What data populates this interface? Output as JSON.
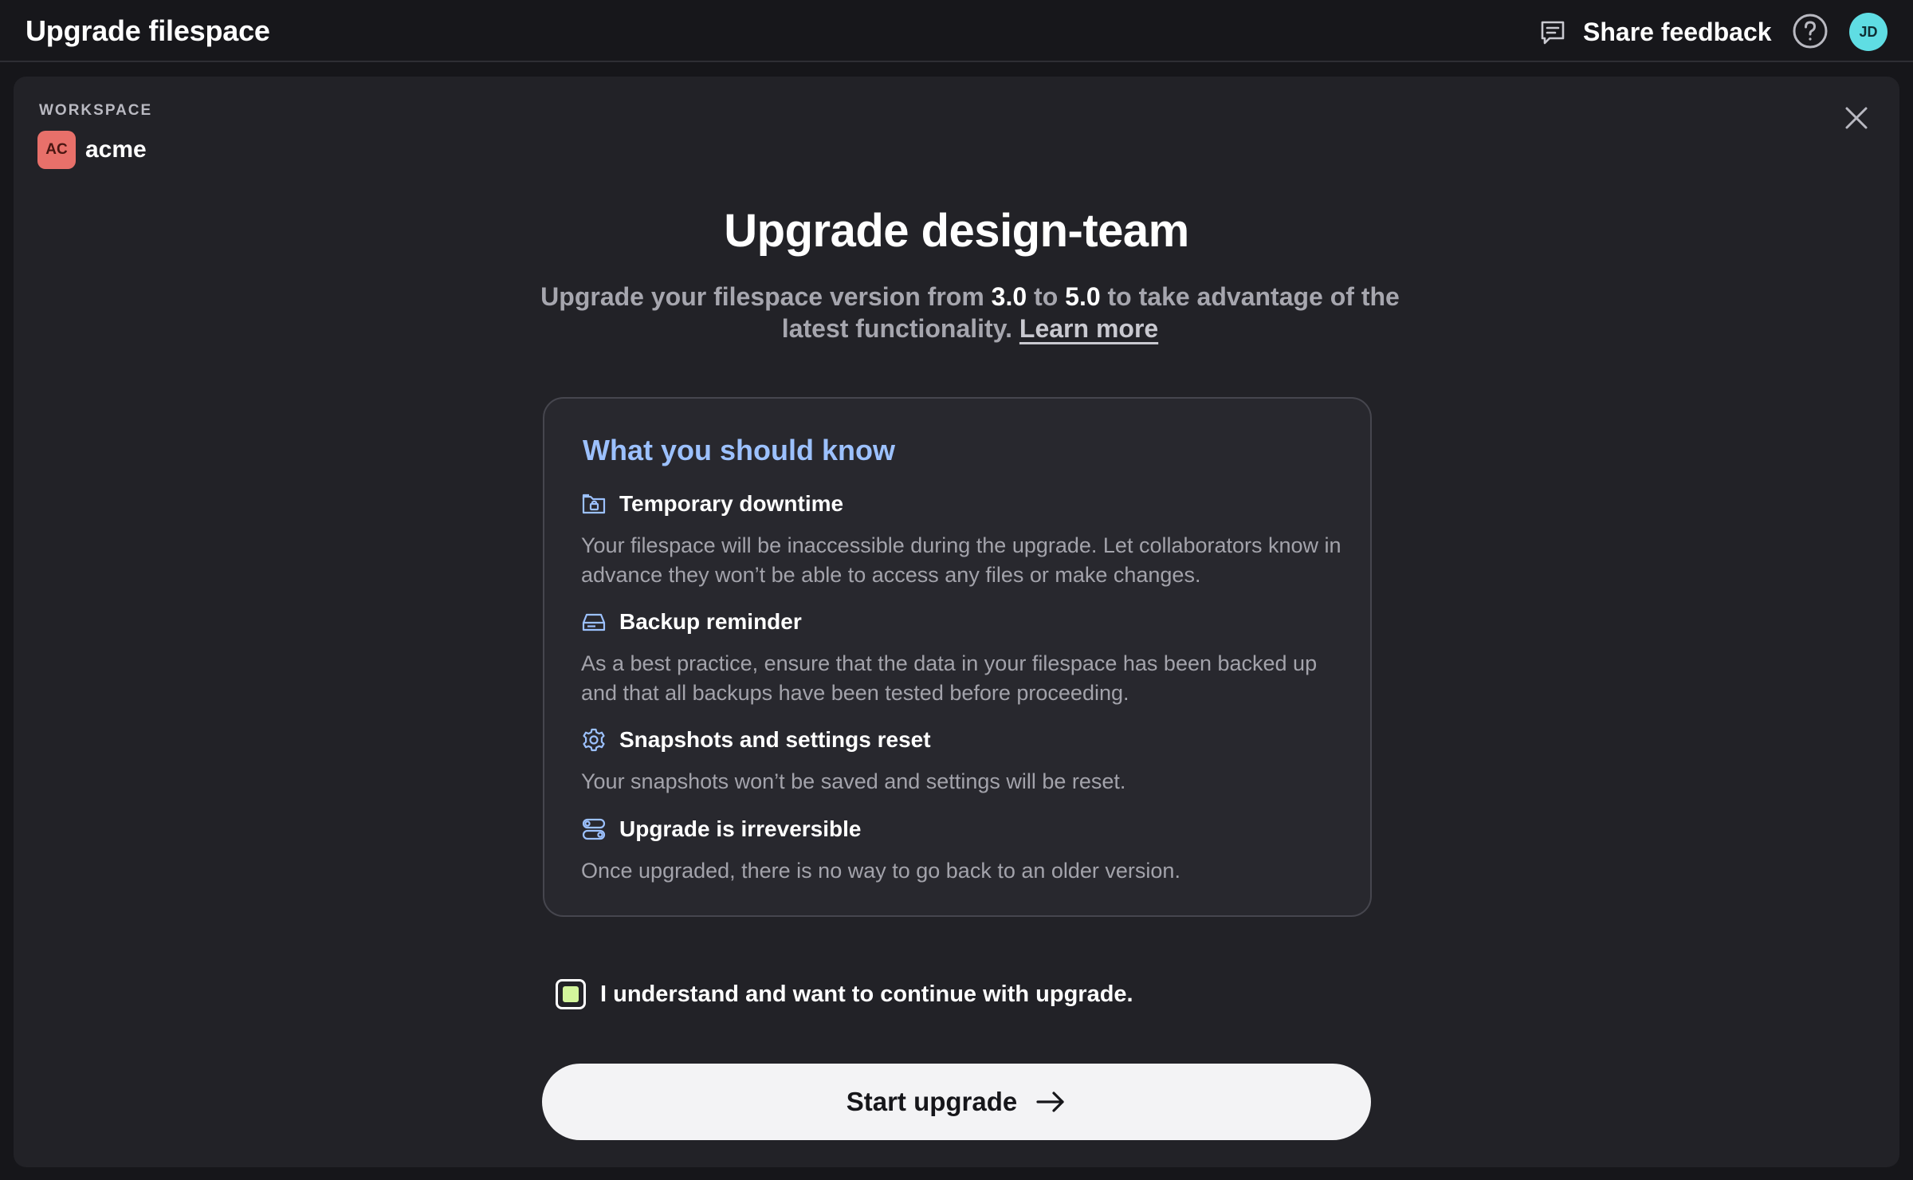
{
  "header": {
    "title": "Upgrade filespace",
    "feedback_label": "Share feedback",
    "feedback_icon": "chat-feedback-icon",
    "help_icon": "help-circle-icon",
    "avatar_initials": "JD",
    "avatar_color": "#5fdde3"
  },
  "workspace": {
    "label": "WORKSPACE",
    "badge": "AC",
    "badge_color": "#e8706a",
    "name": "acme"
  },
  "main": {
    "title": "Upgrade design-team",
    "subtitle_pre": "Upgrade your filespace version from ",
    "from_version": "3.0",
    "subtitle_mid": " to ",
    "to_version": "5.0",
    "subtitle_post": " to take advantage of the latest functionality. ",
    "learn_more": "Learn more"
  },
  "card": {
    "title": "What you should know",
    "items": [
      {
        "icon": "folder-lock-icon",
        "title": "Temporary downtime",
        "body": "Your filespace will be inaccessible during the upgrade. Let collaborators know in advance they won’t be able to access any files or make changes."
      },
      {
        "icon": "hard-drive-icon",
        "title": "Backup reminder",
        "body": "As a best practice, ensure that the data in your filespace has been backed up and that all backups have been tested before proceeding."
      },
      {
        "icon": "gear-icon",
        "title": "Snapshots and settings reset",
        "body": "Your snapshots won’t be saved and settings will be reset."
      },
      {
        "icon": "toggles-icon",
        "title": "Upgrade is irreversible",
        "body": "Once upgraded, there is no way to go back to an older version."
      }
    ]
  },
  "confirm": {
    "label": "I understand and want to continue with upgrade.",
    "checked": true,
    "check_color": "#d3f59c"
  },
  "actions": {
    "start_label": "Start upgrade",
    "start_icon": "arrow-right-icon"
  },
  "colors": {
    "accent_blue": "#9cc1ff",
    "panel_bg": "#222227",
    "button_bg": "#f3f3f5"
  }
}
